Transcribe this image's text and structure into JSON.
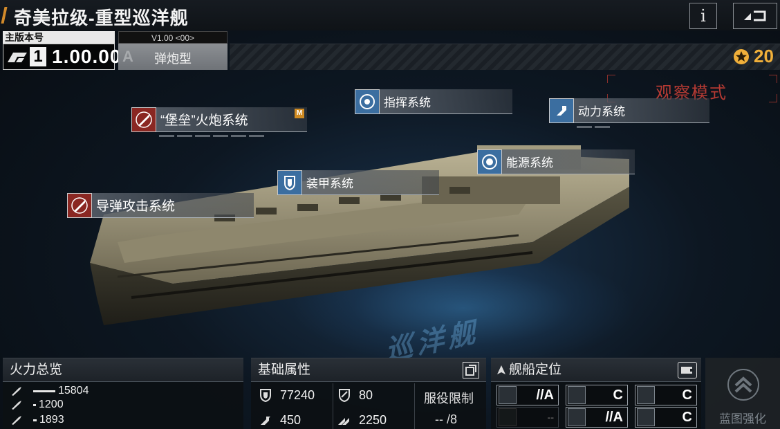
{
  "header": {
    "title": "奇美拉级-重型巡洋舰",
    "info_label": "i"
  },
  "version": {
    "label": "主版本号",
    "major": "1",
    "number": "1.00.00"
  },
  "variant": {
    "version_tag": "V1.00 <00>",
    "grade": "A",
    "name": "弹炮型"
  },
  "currency": {
    "icon": "star-medal-icon",
    "value": "20",
    "color": "#f1b03a"
  },
  "observe_mode": "观察模式",
  "systems": {
    "command": "指挥系统",
    "power": "动力系统",
    "cannon": "“堡垒”火炮系统",
    "cannon_badge": "M",
    "energy": "能源系统",
    "armor": "装甲系统",
    "missile": "导弹攻击系统"
  },
  "deck_text": "巡洋舰",
  "firepower": {
    "title": "火力总览",
    "rows": [
      {
        "value": "15804",
        "fill": 1.0
      },
      {
        "value": "1200",
        "fill": 0.08
      },
      {
        "value": "1893",
        "fill": 0.12
      }
    ]
  },
  "attributes": {
    "title": "基础属性",
    "hp": "77240",
    "armor": "80",
    "speed": "450",
    "warp": "2250",
    "service_label": "服役限制",
    "service_value": "--  /8"
  },
  "positioning": {
    "title": "舰船定位",
    "cells": [
      {
        "grade": "//A"
      },
      {
        "grade": "C"
      },
      {
        "grade": "C"
      },
      {
        "grade": "--"
      },
      {
        "grade": "//A"
      },
      {
        "grade": "C"
      }
    ]
  },
  "enhance": {
    "label": "蓝图强化"
  },
  "colors": {
    "accent_orange": "#d28a2a",
    "system_red": "#8a2722",
    "system_blue": "#3b6ea0",
    "observe_red": "#b63a33"
  }
}
